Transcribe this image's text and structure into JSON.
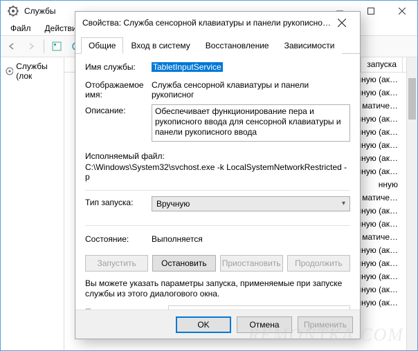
{
  "window": {
    "title": "Службы",
    "menu": {
      "file": "Файл",
      "action": "Действие"
    }
  },
  "tree": {
    "root": "Службы (лок"
  },
  "list": {
    "header_col": "запуска",
    "visible_char": "I",
    "rows": [
      "нную (ак…",
      "нную (ак…",
      "матиче…",
      "нную (ак…",
      "нную (ак…",
      "нную (ак…",
      "нную (ак…",
      "нную (ак…",
      "нную",
      "матиче…",
      "нную (ак…",
      "нную (ак…",
      "матиче…",
      "нную (ак…",
      "нную (ак…",
      "нную (ак…",
      "нную (ак…",
      "нную (ак…"
    ]
  },
  "modal": {
    "title": "Свойства: Служба сенсорной клавиатуры и панели рукописног…",
    "tabs": {
      "general": "Общие",
      "logon": "Вход в систему",
      "recovery": "Восстановление",
      "deps": "Зависимости"
    },
    "labels": {
      "service_name": "Имя службы:",
      "display_name": "Отображаемое имя:",
      "description": "Описание:",
      "executable": "Исполняемый файл:",
      "startup_type": "Тип запуска:",
      "status": "Состояние:",
      "start_params": "Параметры запуска:"
    },
    "values": {
      "service_name": "TabletInputService",
      "display_name": "Служба сенсорной клавиатуры и панели рукописног",
      "description": "Обеспечивает функционирование пера и рукописного ввода для сенсорной клавиатуры и панели рукописного ввода",
      "executable": "C:\\Windows\\System32\\svchost.exe -k LocalSystemNetworkRestricted -p",
      "startup_type": "Вручную",
      "status": "Выполняется"
    },
    "buttons": {
      "start": "Запустить",
      "stop": "Остановить",
      "pause": "Приостановить",
      "resume": "Продолжить",
      "ok": "OK",
      "cancel": "Отмена",
      "apply": "Применить"
    },
    "hint": "Вы можете указать параметры запуска, применяемые при запуске службы из этого диалогового окна."
  },
  "watermark": "REMONTKA.COM"
}
